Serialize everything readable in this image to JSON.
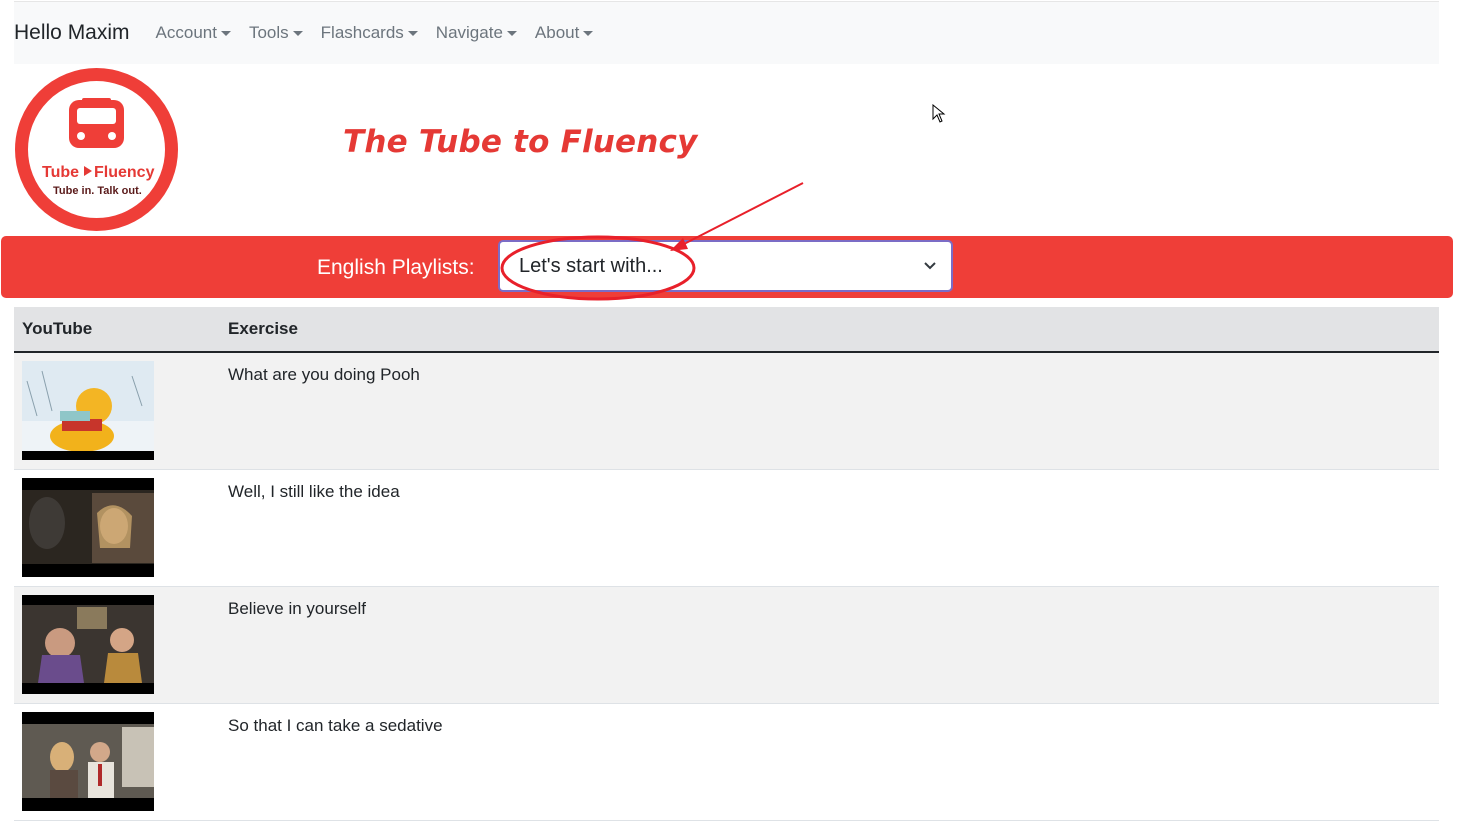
{
  "navbar": {
    "brand": "Hello Maxim",
    "items": [
      {
        "label": "Account"
      },
      {
        "label": "Tools"
      },
      {
        "label": "Flashcards"
      },
      {
        "label": "Navigate"
      },
      {
        "label": "About"
      }
    ]
  },
  "logo": {
    "icon": "tube-train-icon",
    "word1": "Tube",
    "word2": "Fluency",
    "tagline": "Tube in. Talk out."
  },
  "site_title": "The Tube to Fluency",
  "playlist": {
    "label": "English Playlists:",
    "selected": "Let's start with..."
  },
  "table": {
    "headers": {
      "youtube": "YouTube",
      "exercise": "Exercise"
    },
    "rows": [
      {
        "exercise": "What are you doing Pooh",
        "thumbnail": "pooh-snow-scene"
      },
      {
        "exercise": "Well, I still like the idea",
        "thumbnail": "two-people-dark-room"
      },
      {
        "exercise": "Believe in yourself",
        "thumbnail": "woman-and-boy-kitchen"
      },
      {
        "exercise": "So that I can take a sedative",
        "thumbnail": "airplane-cabin-passengers"
      }
    ]
  },
  "colors": {
    "brand_red": "#ef3e38",
    "title_red": "#e53935",
    "navbar_bg": "#f8f9fa",
    "select_border": "#7b6cc6"
  }
}
